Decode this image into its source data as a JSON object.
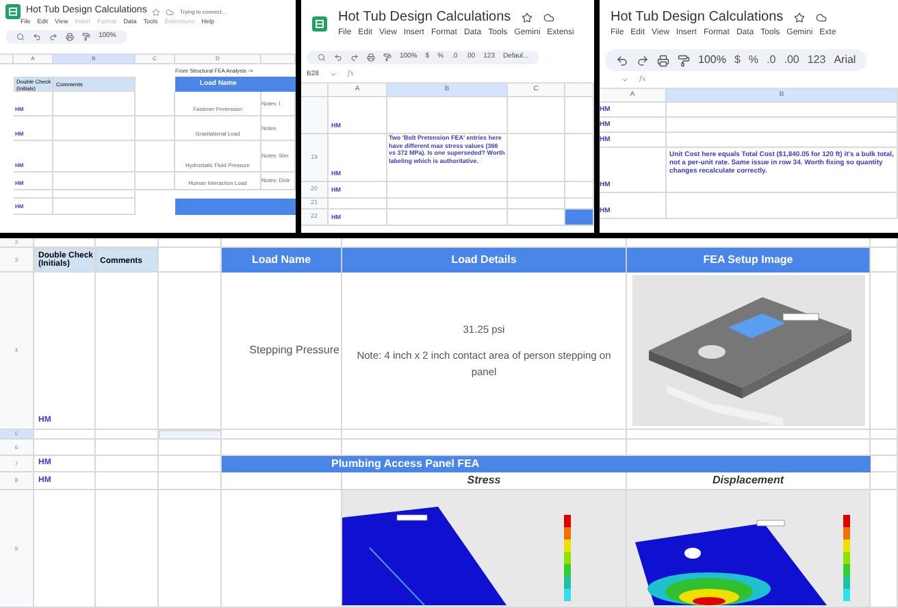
{
  "left_window": {
    "title": "Hot Tub Design Calculations",
    "status": "Trying to connect...",
    "menu": [
      {
        "label": "File",
        "disabled": false
      },
      {
        "label": "Edit",
        "disabled": false
      },
      {
        "label": "View",
        "disabled": false
      },
      {
        "label": "Insert",
        "disabled": true
      },
      {
        "label": "Format",
        "disabled": true
      },
      {
        "label": "Data",
        "disabled": false
      },
      {
        "label": "Tools",
        "disabled": false
      },
      {
        "label": "Extensions",
        "disabled": true
      },
      {
        "label": "Help",
        "disabled": false
      }
    ],
    "zoom": "100%",
    "columns": [
      "A",
      "B",
      "C",
      "D"
    ],
    "source_label": "From Structural FEA Analysis ->",
    "headers": [
      "Double Check (Initials)",
      "Comments",
      "Load Name"
    ],
    "rows": [
      {
        "check": "HM",
        "load": "Fastener Pretension",
        "notes": "Notes: I"
      },
      {
        "check": "HM",
        "load": "Gravitational Load",
        "notes": "Notes"
      },
      {
        "check": "HM",
        "load": "Hydrostatic Fluid Pressure",
        "notes": "Notes: Sim"
      },
      {
        "check": "HM",
        "load": "Human Interaction Load",
        "notes": "Notes: Distr"
      }
    ],
    "last_check": "HM"
  },
  "middle_window": {
    "title": "Hot Tub Design Calculations",
    "menu": [
      "File",
      "Edit",
      "View",
      "Insert",
      "Format",
      "Data",
      "Tools",
      "Gemini",
      "Extensi"
    ],
    "zoom": "100%",
    "tools": [
      "$",
      "%",
      ".0",
      ".00",
      "123"
    ],
    "font": "Defaul...",
    "name_box": "B28",
    "formula_label": "fx",
    "columns": [
      "A",
      "B",
      "C"
    ],
    "rows": [
      {
        "check": "HM"
      },
      {
        "number": "19",
        "check": "HM",
        "comment": "Two 'Bolt Pretension FEA' entries here have different max stress values (366 vs 372 MPa). Is one superseded? Worth labeling which is authoritative."
      },
      {
        "number": "20",
        "check": "HM"
      },
      {
        "number": "21"
      },
      {
        "number": "22",
        "check": "HM"
      }
    ]
  },
  "right_window": {
    "title": "Hot Tub Design Calculations",
    "menu": [
      "File",
      "Edit",
      "View",
      "Insert",
      "Format",
      "Data",
      "Tools",
      "Gemini",
      "Exte"
    ],
    "zoom": "100%",
    "tools": [
      "$",
      "%",
      ".0",
      ".00",
      "123"
    ],
    "font": "Arial",
    "formula_label": "fx",
    "columns": [
      "A",
      "B"
    ],
    "rows": [
      {
        "check": "HM"
      },
      {
        "check": "HM"
      },
      {
        "check": "HM"
      },
      {
        "check": "HM",
        "comment": "Unit Cost here equals Total Cost ($1,840.05 for 120 ft) it's a bulk total, not a per-unit rate. Same issue in row 34. Worth fixing so quantity changes recalculate correctly."
      },
      {
        "check": "HM"
      }
    ]
  },
  "main_sheet": {
    "rows": [
      {
        "kind": "blank",
        "number": "2",
        "selected": false
      },
      {
        "kind": "header",
        "number": "3",
        "cells": [
          "Double Check (Initials)",
          "Comments",
          "Load Name",
          "Load Details",
          "FEA Setup Image"
        ]
      },
      {
        "kind": "load",
        "number": "4",
        "check": "HM",
        "load_name": "Stepping Pressure",
        "value": "31.25 psi",
        "note": "Note: 4 inch x 2 inch contact area of person stepping on panel"
      },
      {
        "kind": "blank",
        "number": "5",
        "selected": true
      },
      {
        "kind": "blank",
        "number": "6",
        "selected": false
      },
      {
        "kind": "section",
        "number": "7",
        "check": "HM",
        "title": "Plumbing Access Panel FEA"
      },
      {
        "kind": "labels",
        "number": "8",
        "check": "HM",
        "labels": [
          "Stress",
          "Displacement"
        ]
      },
      {
        "kind": "images",
        "number": "9"
      }
    ]
  }
}
